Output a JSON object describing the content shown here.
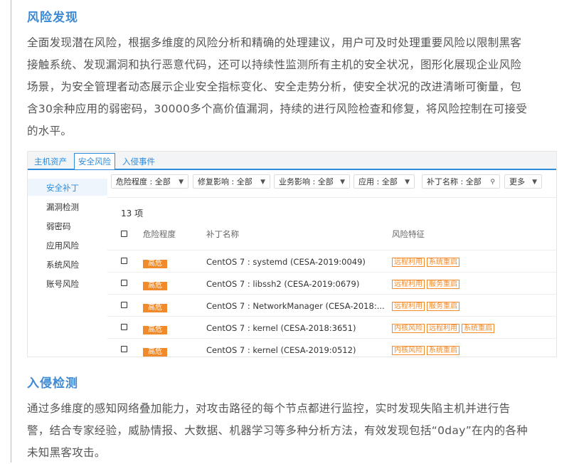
{
  "sections": [
    {
      "title": "风险发现",
      "lines": [
        "全面发现潜在风险，根据多维度的风险分析和精确的处理建议，用户可及时处理重要风险以限制黑客",
        "接触系统、发现漏洞和执行恶意代码，还可以持续性监测所有主机的安全状况，图形化展现企业风险",
        "场景，为安全管理者动态展示企业安全指标变化、安全走势分析，使安全状况的改进清晰可衡量，包",
        "含30余种应用的弱密码，30000多个高价值漏洞，持续的进行风险检查和修复，将风险控制在可接受",
        "的水平。"
      ]
    },
    {
      "title": "入侵检测",
      "lines": [
        "通过多维度的感知网络叠加能力，对攻击路径的每个节点都进行监控，实时发现失陷主机并进行告",
        "警，结合专家经验，威胁情报、大数据、机器学习等多种分析方法，有效发现包括“0day”在内的各种",
        "未知黑客攻击。"
      ]
    }
  ],
  "app": {
    "tabs": [
      "主机资产",
      "安全风险",
      "入侵事件"
    ],
    "active_tab": 1,
    "sidebar": [
      "安全补丁",
      "漏洞检测",
      "弱密码",
      "应用风险",
      "系统风险",
      "账号风险"
    ],
    "filters": [
      {
        "label": "危险程度 : 全部",
        "icon": "filter-icon"
      },
      {
        "label": "修复影响 : 全部",
        "icon": "filter-icon"
      },
      {
        "label": "业务影响 : 全部",
        "icon": "filter-icon"
      },
      {
        "label": "应用 : 全部",
        "icon": "filter-icon"
      },
      {
        "label": "补丁名称 : 全部",
        "icon": "search-icon"
      },
      {
        "label": "更多",
        "icon": "caret-down-icon"
      }
    ],
    "count_label": "13 项",
    "columns": [
      "危险程度",
      "补丁名称",
      "风险特征"
    ],
    "rows": [
      {
        "level": "高危",
        "name": "CentOS 7 : systemd (CESA-2019:0049)",
        "tags": [
          "远程利用",
          "系统重启"
        ]
      },
      {
        "level": "高危",
        "name": "CentOS 7 : libssh2 (CESA-2019:0679)",
        "tags": [
          "远程利用",
          "服务重启"
        ]
      },
      {
        "level": "高危",
        "name": "CentOS 7 : NetworkManager (CESA-2018:...",
        "tags": [
          "远程利用",
          "服务重启"
        ]
      },
      {
        "level": "高危",
        "name": "CentOS 7 : kernel (CESA-2018:3651)",
        "tags": [
          "内核风险",
          "远程利用",
          "系统重启"
        ]
      },
      {
        "level": "高危",
        "name": "CentOS 7 : kernel (CESA-2019:0512)",
        "tags": [
          "内核风险",
          "系统重启"
        ]
      }
    ]
  },
  "colors": {
    "accent": "#3c8ad6",
    "tab_blue": "#2d8cdb",
    "danger": "#f08a2a"
  }
}
